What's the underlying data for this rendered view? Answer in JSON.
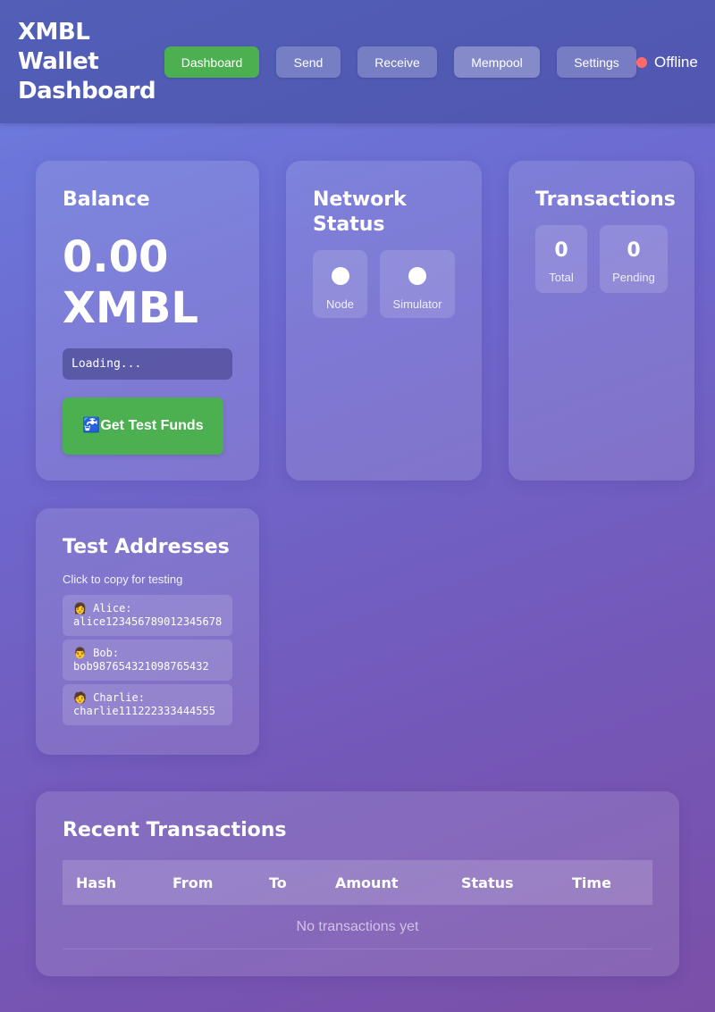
{
  "app": {
    "title": "XMBL Wallet Dashboard"
  },
  "nav": {
    "items": [
      {
        "label": "Dashboard",
        "active": true
      },
      {
        "label": "Send"
      },
      {
        "label": "Receive"
      },
      {
        "label": "Mempool"
      },
      {
        "label": "Settings"
      }
    ]
  },
  "connection": {
    "status": "Offline",
    "status_color": "#ff6b6b"
  },
  "balance": {
    "title": "Balance",
    "amount": "0.00 XMBL",
    "address": "Loading...",
    "faucet_icon": "faucet-icon",
    "faucet_label": "🚰Get Test Funds"
  },
  "network": {
    "title": "Network Status",
    "node_label": "Node",
    "simulator_label": "Simulator"
  },
  "transactions_summary": {
    "title": "Transactions",
    "total_value": "0",
    "total_label": "Total",
    "pending_value": "0",
    "pending_label": "Pending"
  },
  "test_addresses": {
    "title": "Test Addresses",
    "hint": "Click to copy for testing",
    "items": [
      {
        "label": "👩 Alice:",
        "address": "alice123456789012345678"
      },
      {
        "label": "👨 Bob:",
        "address": "bob987654321098765432"
      },
      {
        "label": "🧑 Charlie:",
        "address": "charlie111222333444555"
      }
    ]
  },
  "recent_transactions": {
    "title": "Recent Transactions",
    "columns": [
      "Hash",
      "From",
      "To",
      "Amount",
      "Status",
      "Time"
    ],
    "empty_message": "No transactions yet"
  },
  "colors": {
    "accent_green": "#4caf50",
    "offline_red": "#ff6b6b"
  }
}
